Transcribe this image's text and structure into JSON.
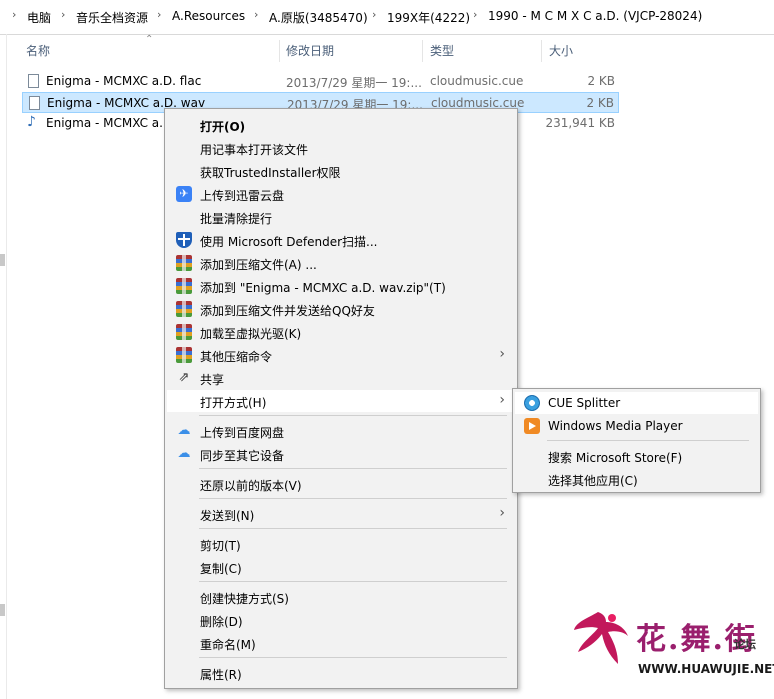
{
  "breadcrumb": [
    "电脑",
    "音乐全档资源",
    "A.Resources",
    "A.原版(3485470)",
    "199X年(4222)",
    "1990 - M C M X C a.D. (VJCP-28024)"
  ],
  "columns": {
    "name": "名称",
    "date": "修改日期",
    "type": "类型",
    "size": "大小"
  },
  "files": [
    {
      "name": "Enigma - MCMXC a.D. flac",
      "date": "2013/7/29 星期一 19:...",
      "type": "cloudmusic.cue",
      "size": "2 KB"
    },
    {
      "name": "Enigma - MCMXC a.D. wav",
      "date": "2013/7/29 星期一 19:...",
      "type": "cloudmusic.cue",
      "size": "2 KB"
    },
    {
      "name": "Enigma - MCMXC a.",
      "date": "",
      "type": "",
      "size": "231,941 KB"
    }
  ],
  "menu": {
    "open": "打开(O)",
    "open_notepad": "用记事本打开该文件",
    "trusted": "获取TrustedInstaller权限",
    "thunder": "上传到迅雷云盘",
    "batch_clear": "批量清除提行",
    "defender": "使用 Microsoft Defender扫描...",
    "add_archive": "添加到压缩文件(A) ...",
    "add_zip": "添加到 \"Enigma - MCMXC a.D. wav.zip\"(T)",
    "add_send_qq": "添加到压缩文件并发送给QQ好友",
    "virtual_drive": "加载至虚拟光驱(K)",
    "other_compress": "其他压缩命令",
    "share": "共享",
    "open_with": "打开方式(H)",
    "baidu_upload": "上传到百度网盘",
    "sync_device": "同步至其它设备",
    "restore": "还原以前的版本(V)",
    "send_to": "发送到(N)",
    "cut": "剪切(T)",
    "copy": "复制(C)",
    "shortcut": "创建快捷方式(S)",
    "delete": "删除(D)",
    "rename": "重命名(M)",
    "properties": "属性(R)"
  },
  "submenu": {
    "cue_splitter": "CUE Splitter",
    "wmp": "Windows Media Player",
    "store": "搜索 Microsoft Store(F)",
    "choose": "选择其他应用(C)"
  },
  "watermark": {
    "brand": "花.舞.街",
    "sub": "论坛",
    "url": "WWW.HUAWUJIE.NET"
  },
  "icons": {
    "sort": "chevron-up-icon",
    "submenu": "chevron-right-icon"
  }
}
